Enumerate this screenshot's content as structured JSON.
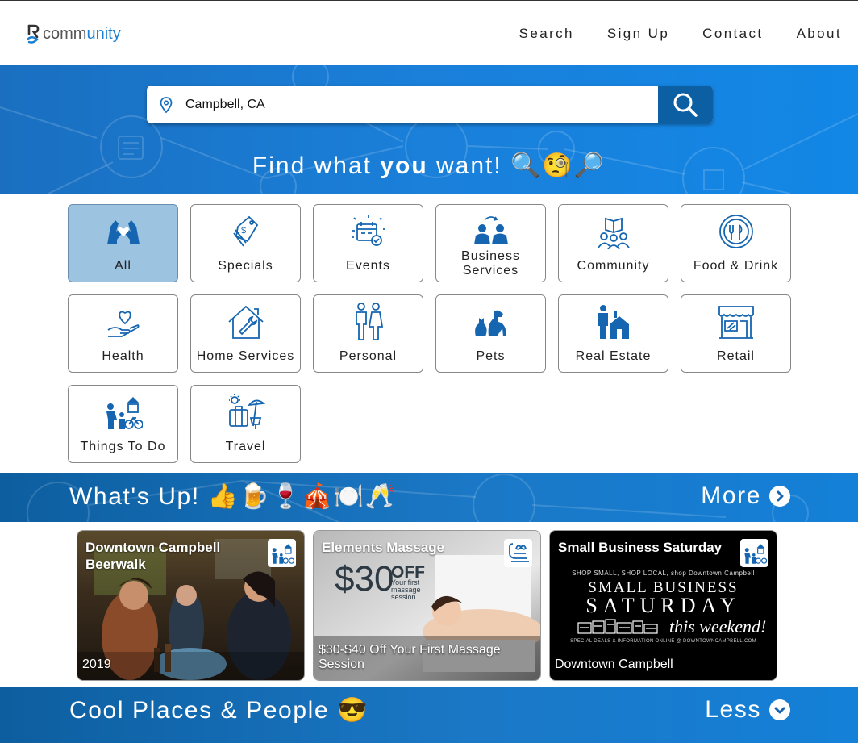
{
  "brand": {
    "logo_prefix": "comm",
    "logo_suffix": "unity"
  },
  "nav": [
    {
      "label": "Search"
    },
    {
      "label": "Sign Up"
    },
    {
      "label": "Contact"
    },
    {
      "label": "About"
    }
  ],
  "search": {
    "value": "Campbell, CA"
  },
  "hero": {
    "title_before": "Find what ",
    "title_bold": "you",
    "title_after": " want! 🔍🧐🔎"
  },
  "categories": [
    {
      "label": "All",
      "icon": "hands-heart-icon",
      "active": true
    },
    {
      "label": "Specials",
      "icon": "price-tag-icon"
    },
    {
      "label": "Events",
      "icon": "calendar-icon"
    },
    {
      "label": "Business Services",
      "icon": "business-people-icon"
    },
    {
      "label": "Community",
      "icon": "community-group-icon"
    },
    {
      "label": "Food & Drink",
      "icon": "plate-utensils-icon"
    },
    {
      "label": "Health",
      "icon": "heart-hand-icon"
    },
    {
      "label": "Home Services",
      "icon": "house-wrench-icon"
    },
    {
      "label": "Personal",
      "icon": "man-woman-icon"
    },
    {
      "label": "Pets",
      "icon": "cat-dog-icon"
    },
    {
      "label": "Real Estate",
      "icon": "realtor-house-icon"
    },
    {
      "label": "Retail",
      "icon": "storefront-icon"
    },
    {
      "label": "Things To Do",
      "icon": "activities-icon"
    },
    {
      "label": "Travel",
      "icon": "luggage-beach-icon"
    }
  ],
  "whats_up": {
    "title": "What's Up! 👍🍺🍷🎪🍽️🥂",
    "more": "More"
  },
  "cards": [
    {
      "title": "Downtown Campbell Beerwalk",
      "caption": "2019",
      "badge_icon": "activities-icon"
    },
    {
      "title": "Elements Massage",
      "caption": "$30-$40 Off Your First Massage Session",
      "badge_icon": "spa-icon",
      "promo_price": "$30",
      "promo_off": "OFF",
      "promo_sub": "Your first massage session"
    },
    {
      "title": "Small Business Saturday",
      "caption": "Downtown Campbell",
      "badge_icon": "activities-icon",
      "promo_line1": "SHOP SMALL, SHOP LOCAL, shop Downtown Campbell",
      "promo_line2": "SMALL BUSINESS",
      "promo_line3": "SATURDAY",
      "promo_line4": "this weekend!",
      "promo_line5": "SPECIAL DEALS & INFORMATION ONLINE @ DOWNTOWNCAMPBELL.COM"
    }
  ],
  "cool_places": {
    "title": "Cool Places & People 😎",
    "less": "Less"
  },
  "colors": {
    "brand_blue": "#1a7fd0",
    "dark_blue": "#0d5fa4",
    "icon_blue": "#1565b0",
    "active_tile": "#9cc3e0"
  }
}
